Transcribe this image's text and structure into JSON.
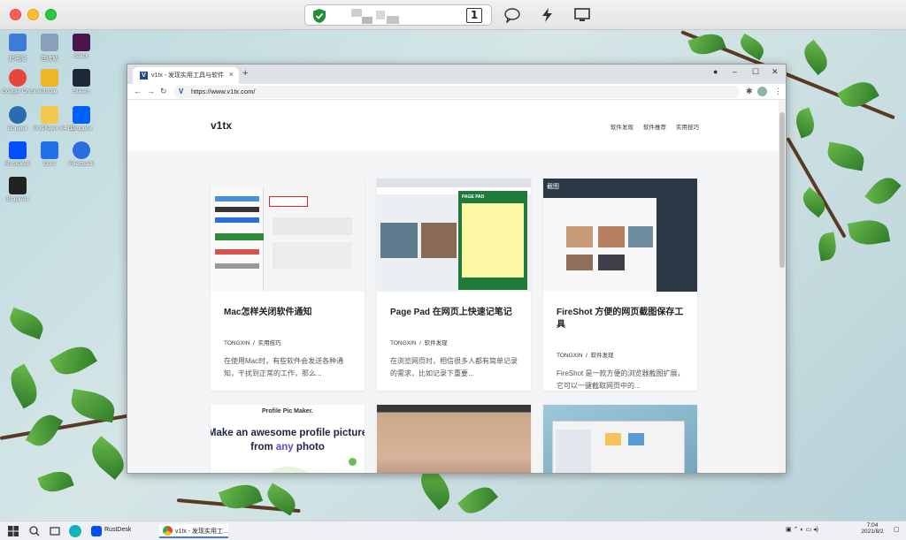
{
  "outer_window": {
    "page_number": "1"
  },
  "desktop_icons": [
    {
      "label": "此电脑",
      "color": "#3d7bd9"
    },
    {
      "label": "回收站",
      "color": "#8aa0b8"
    },
    {
      "label": "Slack",
      "color": "#4a154b"
    },
    {
      "label": "Google Chrome",
      "color": "#e8453c"
    },
    {
      "label": "Xnote",
      "color": "#f0b429"
    },
    {
      "label": "Steam",
      "color": "#1b2838"
    },
    {
      "label": "Bonjour",
      "color": "#2b6cb0"
    },
    {
      "label": "PotPlayer 64 bit",
      "color": "#f2c94c"
    },
    {
      "label": "Dropbox",
      "color": "#0061fe"
    },
    {
      "label": "RustDesk",
      "color": "#024eff"
    },
    {
      "label": "Duet",
      "color": "#1f6fe5"
    },
    {
      "label": "Feedback",
      "color": "#2d6cdf"
    },
    {
      "label": "Brackets",
      "color": "#222222"
    }
  ],
  "browser": {
    "tab_title": "v1tx - 发现实用工具与软件",
    "url": "https://www.v1tx.com/"
  },
  "site": {
    "brand": "v1tx",
    "nav": [
      "软件发现",
      "软件推荐",
      "实用技巧"
    ]
  },
  "cards": [
    {
      "title": "Mac怎样关闭软件通知",
      "author": "TONGXIN",
      "sep": "/",
      "category": "实用技巧",
      "excerpt": "在使用Mac时，有些软件会发送各种通知，干扰到正常的工作，那么..."
    },
    {
      "title": "Page Pad 在网页上快速记笔记",
      "author": "TONGXIN",
      "sep": "/",
      "category": "软件发现",
      "excerpt": "在浏览网页时，相信很多人都有简单记录的需求，比如记录下重要..."
    },
    {
      "title": "FireShot 方便的网页截图保存工具",
      "author": "TONGXIN",
      "sep": "/",
      "category": "软件发现",
      "excerpt": "FireShot 是一款方便的浏览器截图扩展，它可以一键截取网页中的..."
    }
  ],
  "card_row2": {
    "profile_brand": "Profile Pic Maker.",
    "profile_headline_1": "Make an awesome profile picture",
    "profile_headline_2a": "from ",
    "profile_headline_2b": "any",
    "profile_headline_2c": " photo"
  },
  "thumb_text": {
    "pagepad_label": "PAGE PAD",
    "fireshot_label": "截图"
  },
  "taskbar": {
    "rustdesk": "RustDesk",
    "browser_item": "v1tx - 发现实用工...",
    "time": "7:04",
    "date": "2021/8/2"
  }
}
